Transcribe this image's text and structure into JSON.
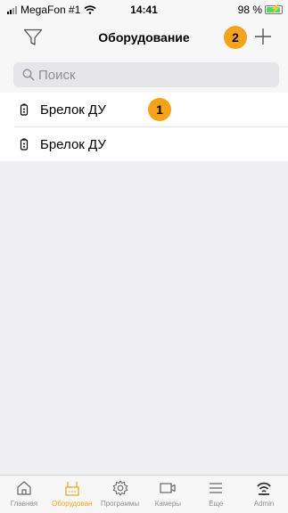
{
  "status_bar": {
    "carrier": "MegaFon #1",
    "time": "14:41",
    "battery": "98 %"
  },
  "nav": {
    "title": "Оборудование"
  },
  "search": {
    "placeholder": "Поиск"
  },
  "annotations": {
    "badge_1": "1",
    "badge_2": "2"
  },
  "devices": [
    {
      "label": "Брелок ДУ",
      "icon": "key-fob-icon"
    },
    {
      "label": "Брелок ДУ",
      "icon": "key-fob-icon"
    }
  ],
  "tabs": [
    {
      "label": "Главная",
      "icon": "home-icon",
      "active": false
    },
    {
      "label": "Оборудован",
      "icon": "equipment-icon",
      "active": true
    },
    {
      "label": "Программы",
      "icon": "gear-icon",
      "active": false
    },
    {
      "label": "Камеры",
      "icon": "camera-icon",
      "active": false
    },
    {
      "label": "Еще",
      "icon": "menu-icon",
      "active": false
    },
    {
      "label": "Admin",
      "icon": "admin-icon",
      "active": false
    }
  ],
  "colors": {
    "accent": "#f5a31a",
    "battery": "#4cd964",
    "inactive": "#8e8e93"
  }
}
